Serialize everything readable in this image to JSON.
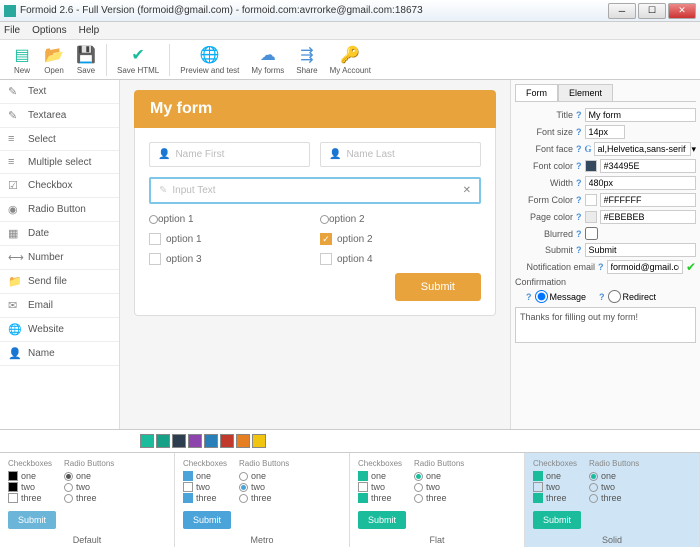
{
  "window": {
    "title": "Formoid 2.6 - Full Version (formoid@gmail.com) - formoid.com:avrrorke@gmail.com:18673"
  },
  "menu": {
    "file": "File",
    "options": "Options",
    "help": "Help"
  },
  "toolbar": {
    "new": "New",
    "open": "Open",
    "save": "Save",
    "saveHtml": "Save HTML",
    "preview": "Preview and test",
    "myforms": "My forms",
    "share": "Share",
    "account": "My Account"
  },
  "sidebar": {
    "items": [
      {
        "icon": "✎",
        "label": "Text"
      },
      {
        "icon": "✎",
        "label": "Textarea"
      },
      {
        "icon": "≡",
        "label": "Select"
      },
      {
        "icon": "≡",
        "label": "Multiple select"
      },
      {
        "icon": "☑",
        "label": "Checkbox"
      },
      {
        "icon": "◉",
        "label": "Radio Button"
      },
      {
        "icon": "▦",
        "label": "Date"
      },
      {
        "icon": "⟷",
        "label": "Number"
      },
      {
        "icon": "📁",
        "label": "Send file"
      },
      {
        "icon": "✉",
        "label": "Email"
      },
      {
        "icon": "🌐",
        "label": "Website"
      },
      {
        "icon": "👤",
        "label": "Name"
      }
    ]
  },
  "form": {
    "title": "My form",
    "nameFirst": "Name First",
    "nameLast": "Name Last",
    "inputText": "Input Text",
    "radio": [
      "option 1",
      "option 2"
    ],
    "check": [
      "option 1",
      "option 2",
      "option 3",
      "option 4"
    ],
    "checkedIndex": 1,
    "submit": "Submit"
  },
  "props": {
    "tabs": {
      "form": "Form",
      "element": "Element"
    },
    "title": {
      "label": "Title",
      "value": "My form"
    },
    "fontSize": {
      "label": "Font size",
      "value": "14px"
    },
    "fontFace": {
      "label": "Font face",
      "value": "al,Helvetica,sans-serif"
    },
    "fontColor": {
      "label": "Font color",
      "value": "#34495E",
      "swatch": "#34495E"
    },
    "width": {
      "label": "Width",
      "value": "480px"
    },
    "formColor": {
      "label": "Form Color",
      "value": "#FFFFFF",
      "swatch": "#FFFFFF"
    },
    "pageColor": {
      "label": "Page color",
      "value": "#EBEBEB",
      "swatch": "#EBEBEB"
    },
    "blurred": {
      "label": "Blurred"
    },
    "submit": {
      "label": "Submit",
      "value": "Submit"
    },
    "notifEmail": {
      "label": "Notification email",
      "value": "formoid@gmail.com"
    },
    "confirmation": {
      "label": "Confirmation",
      "message": "Message",
      "redirect": "Redirect",
      "text": "Thanks for filling out my form!"
    }
  },
  "palette": [
    "#1abc9c",
    "#16a085",
    "#2c3e50",
    "#8e44ad",
    "#2980b9",
    "#c0392b",
    "#e67e22",
    "#f1c40f"
  ],
  "themes": {
    "checkboxes": "Checkboxes",
    "radios": "Radio Buttons",
    "opts": [
      "one",
      "two",
      "three"
    ],
    "submit": "Submit",
    "names": [
      "Default",
      "Metro",
      "Flat",
      "Solid"
    ],
    "colors": [
      "#6bb5d8",
      "#4aa3d9",
      "#1abc9c",
      "#1abc9c"
    ]
  }
}
